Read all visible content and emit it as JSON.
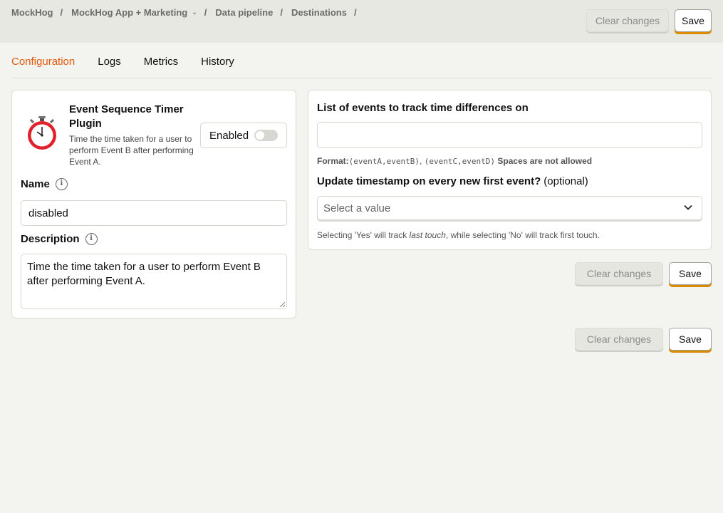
{
  "breadcrumbs": [
    "MockHog",
    "MockHog App + Marketing",
    "Data pipeline",
    "Destinations"
  ],
  "header": {
    "clear_label": "Clear changes",
    "save_label": "Save"
  },
  "tabs": [
    "Configuration",
    "Logs",
    "Metrics",
    "History"
  ],
  "plugin": {
    "title": "Event Sequence Timer Plugin",
    "description": "Time the time taken for a user to perform Event B after performing Event A.",
    "enabled_label": "Enabled",
    "enabled": false
  },
  "name_field": {
    "label": "Name",
    "value": "disabled"
  },
  "description_field": {
    "label": "Description",
    "value": "Time the time taken for a user to perform Event B after performing Event A."
  },
  "events_field": {
    "label": "List of events to track time differences on",
    "value": "",
    "format_label": "Format:",
    "format_example_1": "(eventA,eventB)",
    "format_comma": ",",
    "format_example_2": "(eventC,eventD)",
    "format_note": "Spaces are not allowed"
  },
  "timestamp_field": {
    "label": "Update timestamp on every new first event?",
    "optional": "(optional)",
    "placeholder": "Select a value",
    "hint_before": "Selecting 'Yes' will track ",
    "hint_italic": "last touch",
    "hint_after": ", while selecting 'No' will track first touch."
  },
  "config_actions": {
    "clear_label": "Clear changes",
    "save_label": "Save"
  },
  "footer_actions": {
    "clear_label": "Clear changes",
    "save_label": "Save"
  },
  "colors": {
    "accent": "#e25a0b",
    "save_shadow": "#d98a00",
    "plugin_icon": "#e0202a"
  },
  "icons": {
    "plugin": "stopwatch-icon",
    "info": "info-icon",
    "chevron": "chevron-down-icon"
  }
}
